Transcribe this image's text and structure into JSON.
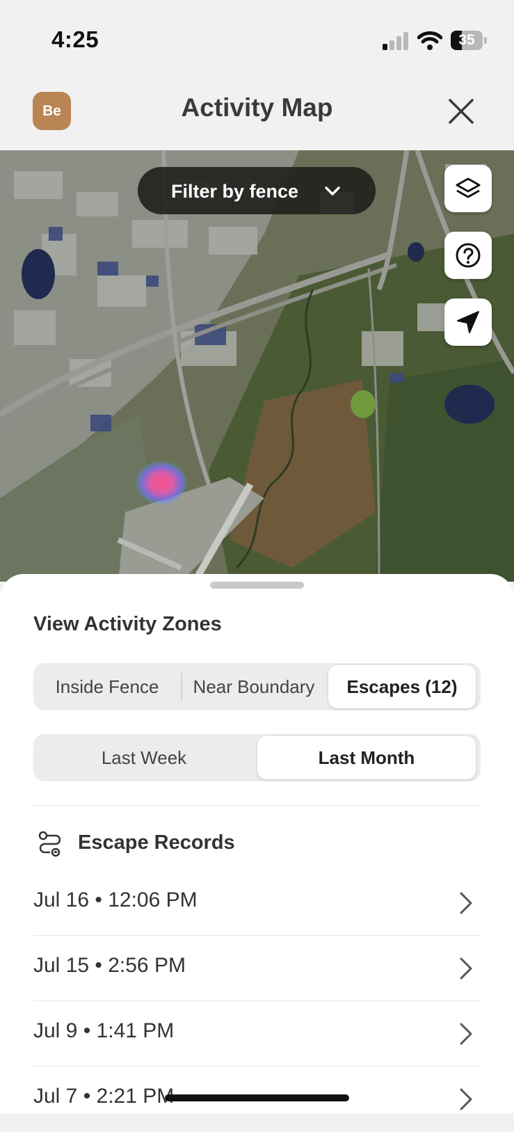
{
  "status_bar": {
    "time": "4:25",
    "battery": "35",
    "battery_level": 0.35
  },
  "header": {
    "avatar_initials": "Be",
    "title": "Activity Map"
  },
  "map": {
    "filter_label": "Filter by fence",
    "buttons": [
      "layers-icon",
      "help-icon",
      "location-arrow-icon"
    ]
  },
  "sheet": {
    "section_title": "View Activity Zones",
    "zone_tabs": [
      "Inside Fence",
      "Near Boundary",
      "Escapes (12)"
    ],
    "zone_selected": "Escapes (12)",
    "period_tabs": [
      "Last Week",
      "Last Month"
    ],
    "period_selected": "Last Month",
    "records_title": "Escape Records",
    "records": [
      "Jul 16 • 12:06 PM",
      "Jul 15 • 2:56 PM",
      "Jul 9 • 1:41 PM",
      "Jul 7 • 2:21 PM"
    ]
  },
  "colors": {
    "avatar": "#b98554",
    "pill": "#1c1e1a",
    "sheet": "#ffffff"
  }
}
